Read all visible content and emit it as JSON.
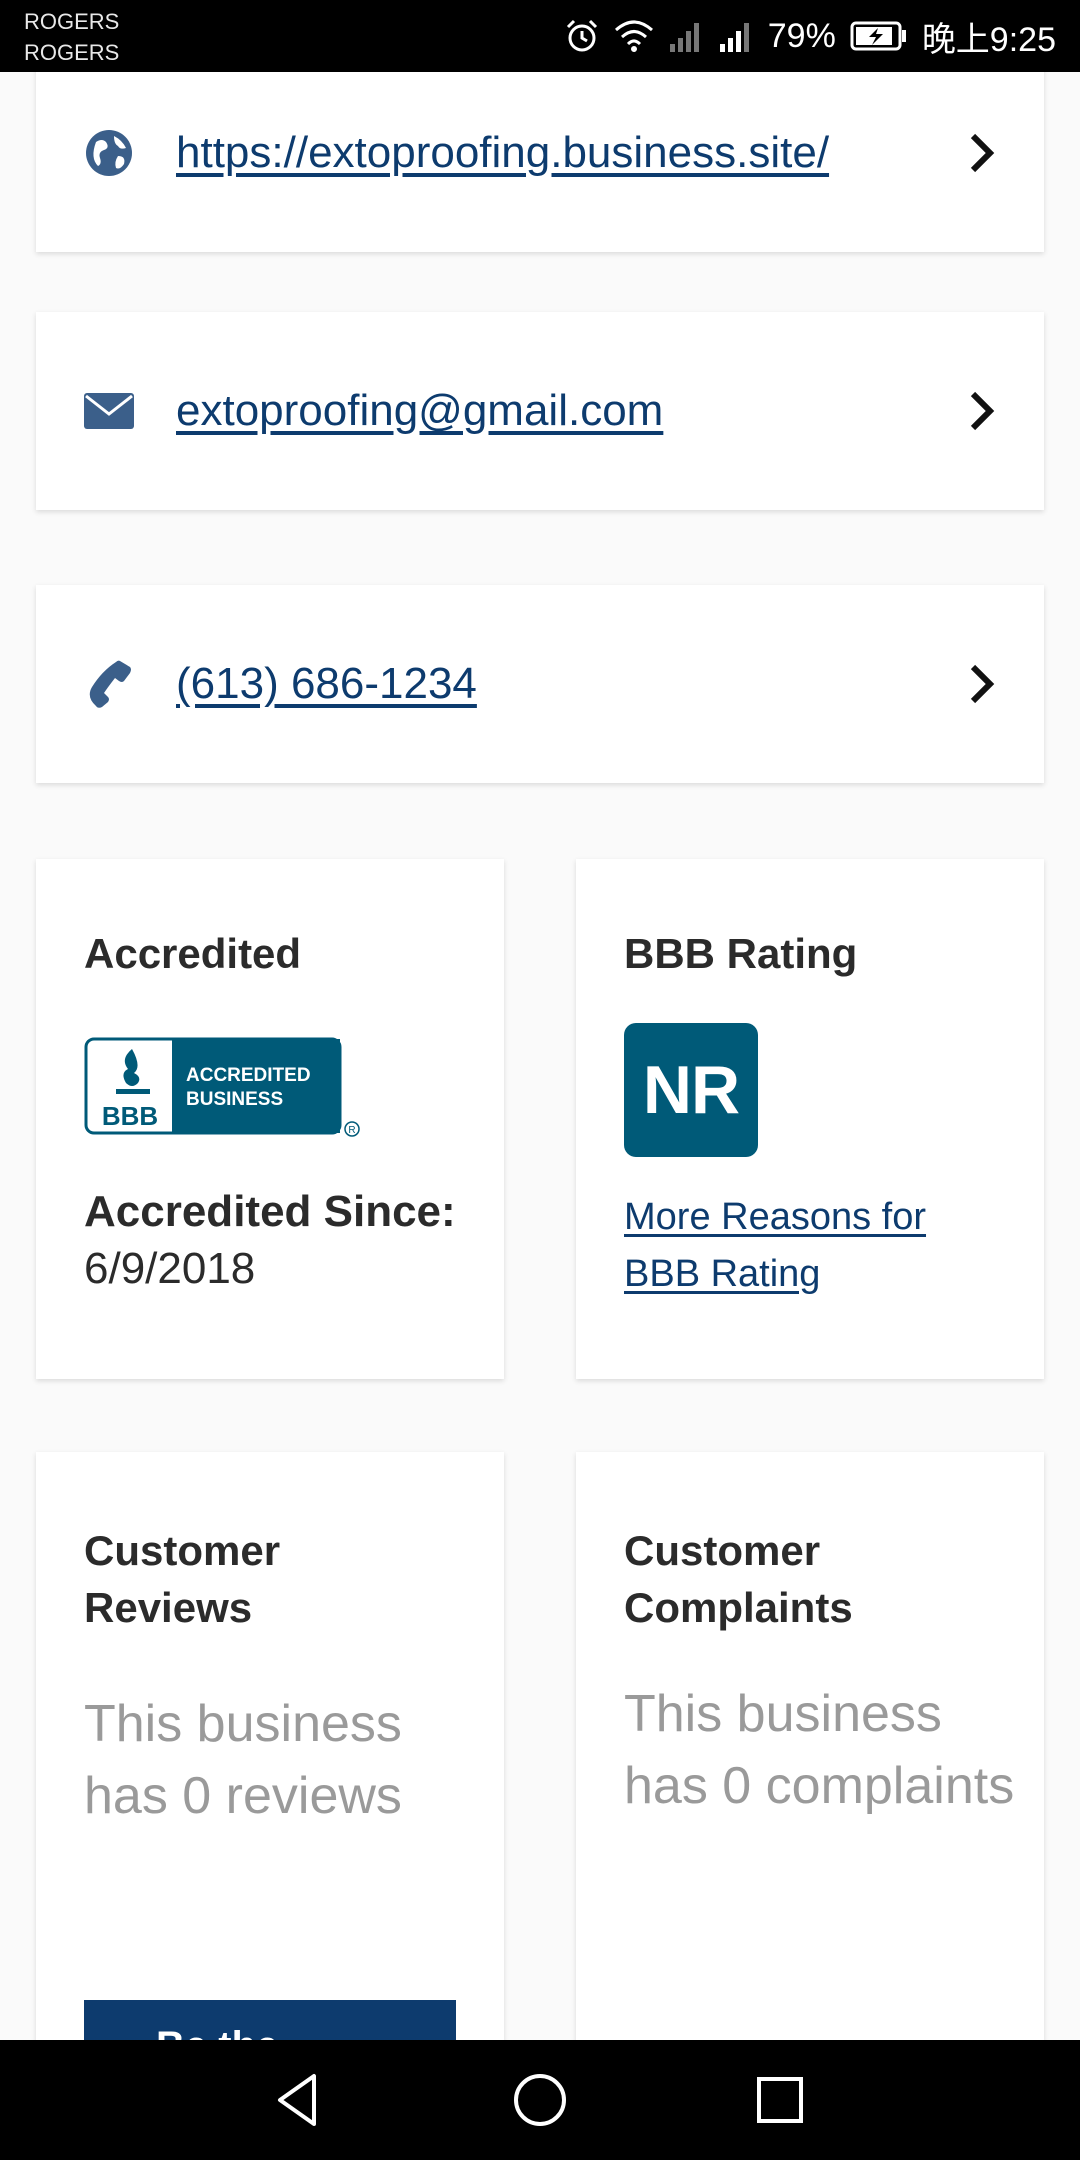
{
  "status_bar": {
    "carrier_line1": "ROGERS",
    "carrier_line2": "ROGERS",
    "battery": "79%",
    "time": "晚上9:25",
    "icons": [
      "alarm-icon",
      "wifi-icon",
      "signal-icon",
      "signal-icon",
      "battery-charging-icon"
    ]
  },
  "contacts": [
    {
      "icon": "globe-icon",
      "text": "https://extoproofing.business.site/"
    },
    {
      "icon": "envelope-icon",
      "text": "extoproofing@gmail.com"
    },
    {
      "icon": "phone-icon",
      "text": "(613) 686-1234"
    }
  ],
  "accredited": {
    "title": "Accredited",
    "logo": {
      "line1": "ACCREDITED",
      "line2": "BUSINESS",
      "brand": "BBB"
    },
    "since_label": "Accredited Since:",
    "since_value": "6/9/2018"
  },
  "rating": {
    "title": "BBB Rating",
    "value": "NR",
    "link": "More Reasons for BBB Rating"
  },
  "reviews": {
    "title": "Customer Reviews",
    "text": "This business has 0 reviews",
    "button": "Be the"
  },
  "complaints": {
    "title": "Customer Complaints",
    "text": "This business has 0 complaints"
  },
  "colors": {
    "link": "#0d3b6e",
    "bbb_teal": "#005a78",
    "icon": "#3b5f8a",
    "muted": "#9a9a9a"
  }
}
